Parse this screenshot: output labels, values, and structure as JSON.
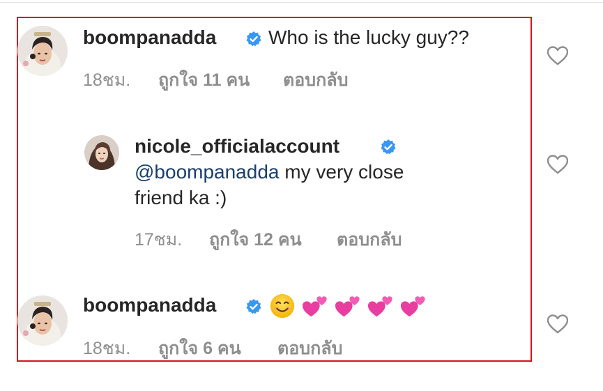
{
  "colors": {
    "highlight": "#d1141b",
    "username": "#262626",
    "meta": "#8e8e8e",
    "mention": "#1a3e6e",
    "verified": "#3897f0"
  },
  "comments": [
    {
      "username": "boompanadda",
      "verified": true,
      "text": "Who is the lucky guy??",
      "time": "18ชม.",
      "likes": "ถูกใจ 11 คน",
      "reply": "ตอบกลับ",
      "like_icon": "heart-outline-icon"
    },
    {
      "username": "nicole_officialaccount",
      "verified": true,
      "mention": "@boompanadda",
      "text_line1": " my very close",
      "text_line2": "friend ka :)",
      "time": "17ชม.",
      "likes": "ถูกใจ 12 คน",
      "reply": "ตอบกลับ",
      "like_icon": "heart-outline-icon"
    },
    {
      "username": "boompanadda",
      "verified": true,
      "emojis": [
        "smiling-face-emoji",
        "two-hearts-emoji",
        "two-hearts-emoji",
        "two-hearts-emoji",
        "two-hearts-emoji"
      ],
      "time": "18ชม.",
      "likes": "ถูกใจ 6 คน",
      "reply": "ตอบกลับ",
      "like_icon": "heart-outline-icon"
    }
  ]
}
